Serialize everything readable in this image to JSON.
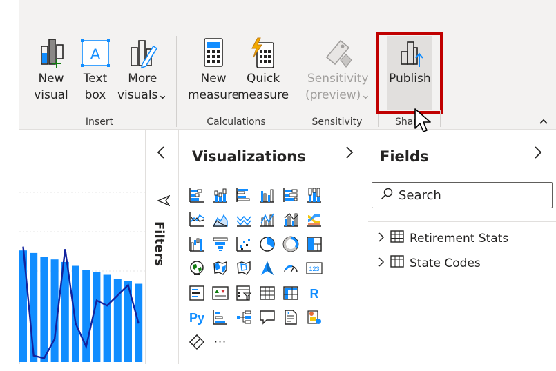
{
  "ribbon": {
    "insert": {
      "group_label": "Insert",
      "new_visual": "New\nvisual",
      "text_box": "Text\nbox",
      "more_visuals": "More\nvisuals⌄"
    },
    "calculations": {
      "group_label": "Calculations",
      "new_measure": "New\nmeasure",
      "quick_measure": "Quick\nmeasure"
    },
    "sensitivity": {
      "group_label": "Sensitivity",
      "sensitivity_preview": "Sensitivity\n(preview)⌄"
    },
    "share": {
      "group_label": "Shar",
      "publish": "Publish"
    }
  },
  "filters_pane": {
    "label": "Filters"
  },
  "visualizations_pane": {
    "title": "Visualizations",
    "more_label": "···"
  },
  "fields_pane": {
    "title": "Fields",
    "search_placeholder": "Search",
    "tables": [
      "Retirement Stats",
      "State Codes"
    ]
  },
  "chart_data": {
    "type": "bar",
    "bar_values": [
      0.87,
      0.85,
      0.82,
      0.8,
      0.78,
      0.75,
      0.72,
      0.7,
      0.68,
      0.65,
      0.63,
      0.61
    ],
    "line_values": [
      0.9,
      0.05,
      0.03,
      0.18,
      0.88,
      0.3,
      0.12,
      0.48,
      0.44,
      0.52,
      0.6,
      0.3
    ],
    "bar_color": "#118dff",
    "line_color": "#12239e"
  },
  "colors": {
    "accent": "#118dff",
    "highlight_border": "#c00000",
    "ribbon_bg": "#f3f2f1"
  }
}
